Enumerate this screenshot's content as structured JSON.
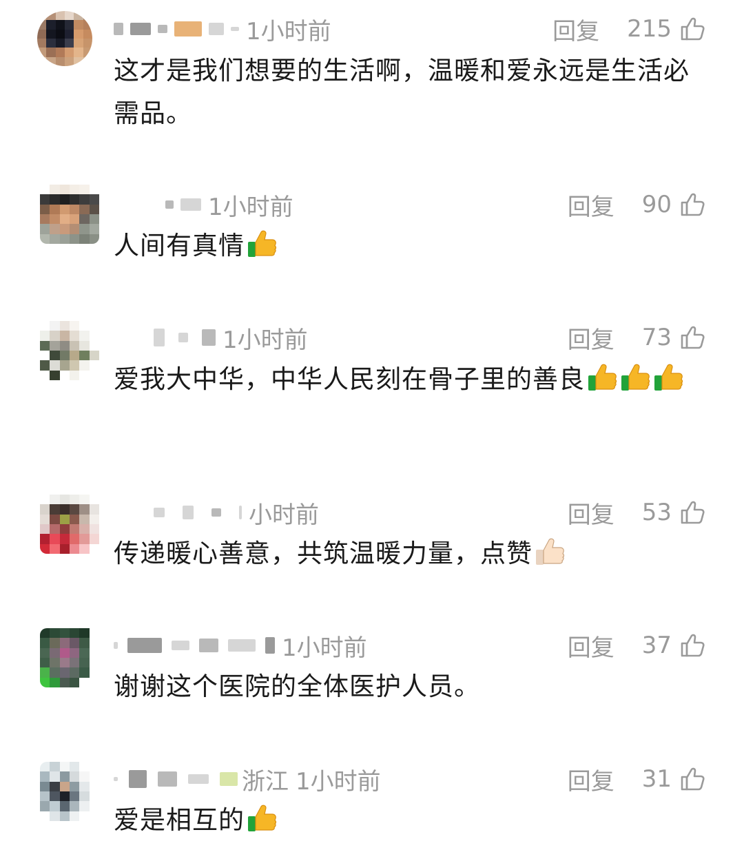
{
  "comments": [
    {
      "time": "1小时前",
      "location": "",
      "reply_label": "回复",
      "likes": "215",
      "text": "这才是我们想要的生活啊，温暖和爱永远是生活必需品。"
    },
    {
      "time": "1小时前",
      "location": "",
      "reply_label": "回复",
      "likes": "90",
      "text": "人间有真情",
      "emojis": [
        "thumbs-up"
      ]
    },
    {
      "time": "1小时前",
      "location": "",
      "reply_label": "回复",
      "likes": "73",
      "text": "爱我大中华，中华人民刻在骨子里的善良",
      "emojis": [
        "thumbs-up",
        "thumbs-up",
        "thumbs-up"
      ]
    },
    {
      "time": "小时前",
      "location": "",
      "reply_label": "回复",
      "likes": "53",
      "text": "传递暖心善意，共筑温暖力量，点赞",
      "emojis": [
        "thumbs-up-light"
      ]
    },
    {
      "time": "1小时前",
      "location": "",
      "reply_label": "回复",
      "likes": "37",
      "text": "谢谢这个医院的全体医护人员。"
    },
    {
      "time": "1小时前",
      "location": "浙江",
      "reply_label": "回复",
      "likes": "31",
      "text": "爱是相互的",
      "emojis": [
        "thumbs-up"
      ]
    }
  ],
  "icons": {
    "like": "thumbs-up-outline-icon",
    "emoji_thumb": "thumbs-up-emoji-icon"
  },
  "colors": {
    "meta_text": "#9a9a9a",
    "body_text": "#1a1a1a",
    "emoji_yellow": "#f6b626",
    "emoji_green": "#22a33a"
  }
}
